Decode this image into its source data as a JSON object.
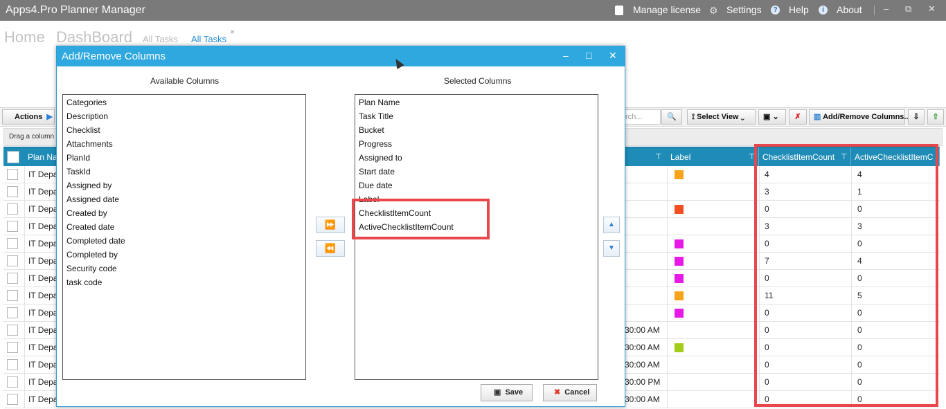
{
  "app": {
    "title": "Apps4.Pro Planner Manager",
    "manage_license": "Manage license",
    "settings": "Settings",
    "help": "Help",
    "about": "About",
    "minimize": "–",
    "restore": "⧉",
    "close": "✕"
  },
  "nav": {
    "home": "Home",
    "dashboard": "DashBoard",
    "all_tasks_1": "All Tasks",
    "all_tasks_2": "All Tasks",
    "close_tab": "×"
  },
  "toolbar": {
    "actions": "Actions",
    "search_placeholder": "rch...",
    "select_view": "Select View",
    "add_remove_columns": "Add/Remove Columns.."
  },
  "grid": {
    "group_hint": "Drag a column h",
    "headers": {
      "plan_name": "Plan Na",
      "label": "Label",
      "checklist_item_count": "ChecklistItemCount",
      "active_checklist_item_count": "ActiveChecklistItemC"
    },
    "rows": [
      {
        "plan": "IT Depa",
        "date": "",
        "label_color": "#f7a21b",
        "c1": "4",
        "c2": "4"
      },
      {
        "plan": "IT Depa",
        "date": "",
        "label_color": "",
        "c1": "3",
        "c2": "1"
      },
      {
        "plan": "IT Depa",
        "date": "",
        "label_color": "#f25022",
        "c1": "0",
        "c2": "0"
      },
      {
        "plan": "IT Depa",
        "date": "",
        "label_color": "",
        "c1": "3",
        "c2": "3"
      },
      {
        "plan": "IT Depa",
        "date": "",
        "label_color": "#e619e6",
        "c1": "0",
        "c2": "0"
      },
      {
        "plan": "IT Depa",
        "date": "",
        "label_color": "#e619e6",
        "c1": "7",
        "c2": "4"
      },
      {
        "plan": "IT Depa",
        "date": "",
        "label_color": "#e619e6",
        "c1": "0",
        "c2": "0"
      },
      {
        "plan": "IT Depa",
        "date": "",
        "label_color": "#f7a21b",
        "c1": "11",
        "c2": "5"
      },
      {
        "plan": "IT Depa",
        "date": "",
        "label_color": "#e619e6",
        "c1": "0",
        "c2": "0"
      },
      {
        "plan": "IT Depa",
        "date": "30:00 AM",
        "label_color": "",
        "c1": "0",
        "c2": "0"
      },
      {
        "plan": "IT Depa",
        "date": "30:00 AM",
        "label_color": "#a4cc1a",
        "c1": "0",
        "c2": "0"
      },
      {
        "plan": "IT Depa",
        "date": "30:00 AM",
        "label_color": "",
        "c1": "0",
        "c2": "0"
      },
      {
        "plan": "IT Depa",
        "date": "30:00 PM",
        "label_color": "",
        "c1": "0",
        "c2": "0"
      },
      {
        "plan": "IT Depa",
        "date": "30:00 AM",
        "label_color": "",
        "c1": "0",
        "c2": "0"
      }
    ]
  },
  "dialog": {
    "title": "Add/Remove Columns",
    "minimize": "–",
    "maximize": "□",
    "close": "✕",
    "available_title": "Available Columns",
    "selected_title": "Selected Columns",
    "available": [
      "Categories",
      "Description",
      "Checklist",
      "Attachments",
      "PlanId",
      "TaskId",
      "Assigned by",
      "Assigned date",
      "Created by",
      "Created date",
      "Completed date",
      "Completed by",
      "Security code",
      "task code"
    ],
    "selected": [
      "Plan Name",
      "Task Title",
      "Bucket",
      "Progress",
      "Assigned to",
      "Start date",
      "Due date",
      "Label",
      "ChecklistItemCount",
      "ActiveChecklistItemCount"
    ],
    "add_all": "⏩",
    "remove_all": "⏪",
    "move_up": "▲",
    "move_down": "▼",
    "save": "Save",
    "cancel": "Cancel"
  },
  "colors": {
    "titlebar": "#7a7a7a",
    "dialog_title": "#2fa8e0",
    "grid_header": "#1f8cb7",
    "highlight": "#e8484b"
  }
}
